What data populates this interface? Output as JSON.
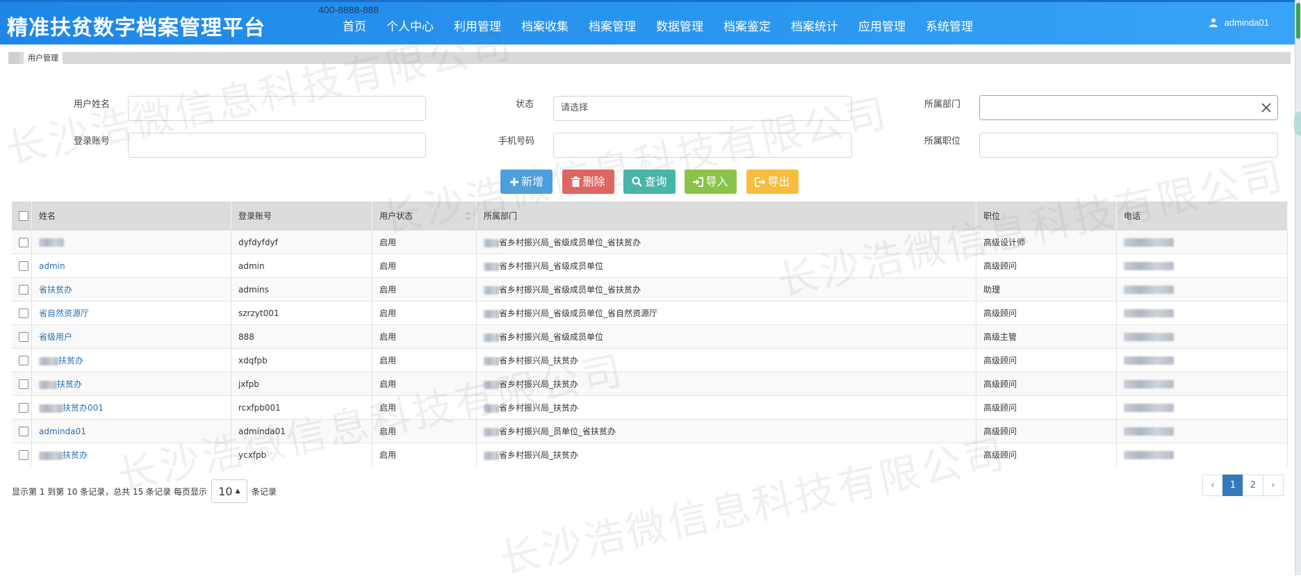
{
  "header": {
    "brand": "精准扶贫数字档案管理平台",
    "hotline": "400-8888-888",
    "nav": [
      "首页",
      "个人中心",
      "利用管理",
      "档案收集",
      "档案管理",
      "数据管理",
      "档案鉴定",
      "档案统计",
      "应用管理",
      "系统管理"
    ],
    "user": "adminda01"
  },
  "breadcrumb": {
    "tab": "用户管理"
  },
  "form": {
    "user_name_label": "用户姓名",
    "status_label": "状态",
    "status_value": "请选择",
    "dept_label": "所属部门",
    "login_label": "登录账号",
    "phone_label": "手机号码",
    "position_label": "所属职位"
  },
  "buttons": {
    "add": "新增",
    "delete": "删除",
    "query": "查询",
    "import": "导入",
    "export": "导出"
  },
  "colors": {
    "add": "#4a9fe0",
    "delete": "#e1655e",
    "query": "#47b5a8",
    "import": "#8bc34a",
    "export": "#f6bd3f",
    "header": "#2b97f0"
  },
  "table": {
    "columns": [
      "姓名",
      "登录账号",
      "用户状态",
      "所属部门",
      "职位",
      "电话"
    ],
    "rows": [
      {
        "name": "",
        "login": "dyfdyfdyf",
        "status": "启用",
        "dept": "省乡村振兴局_省级成员单位_省扶贫办",
        "position": "高级设计师"
      },
      {
        "name": "admin",
        "login": "admin",
        "status": "启用",
        "dept": "省乡村振兴局_省级成员单位",
        "position": "高级顾问"
      },
      {
        "name": "省扶贫办",
        "login": "admins",
        "status": "启用",
        "dept": "省乡村振兴局_省级成员单位_省扶贫办",
        "position": "助理"
      },
      {
        "name": "省自然资源厅",
        "login": "szrzyt001",
        "status": "启用",
        "dept": "省乡村振兴局_省级成员单位_省自然资源厅",
        "position": "高级顾问"
      },
      {
        "name": "省级用户",
        "login": "888",
        "status": "启用",
        "dept": "省乡村振兴局_省级成员单位",
        "position": "高级主管"
      },
      {
        "name": "扶贫办",
        "login": "xdqfpb",
        "status": "启用",
        "dept": "省乡村振兴局_扶贫办",
        "position": "高级顾问"
      },
      {
        "name": "扶贫办",
        "login": "jxfpb",
        "status": "启用",
        "dept": "省乡村振兴局_扶贫办",
        "position": "高级顾问"
      },
      {
        "name": "扶贫办001",
        "login": "rcxfpb001",
        "status": "启用",
        "dept": "省乡村振兴局_扶贫办",
        "position": "高级顾问"
      },
      {
        "name": "adminda01",
        "login": "adminda01",
        "status": "启用",
        "dept": "省乡村振兴局_员单位_省扶贫办",
        "position": "高级顾问"
      },
      {
        "name": "扶贫办",
        "login": "ycxfpb",
        "status": "启用",
        "dept": "省乡村振兴局_扶贫办",
        "position": "高级顾问"
      }
    ]
  },
  "footer": {
    "info_prefix": "显示第 1 到第 10 条记录，总共 15 条记录 每页显示",
    "page_size": "10",
    "info_suffix": "条记录",
    "pages": [
      "‹",
      "1",
      "2",
      "›"
    ]
  },
  "watermark": "长沙浩微信息科技有限公司"
}
